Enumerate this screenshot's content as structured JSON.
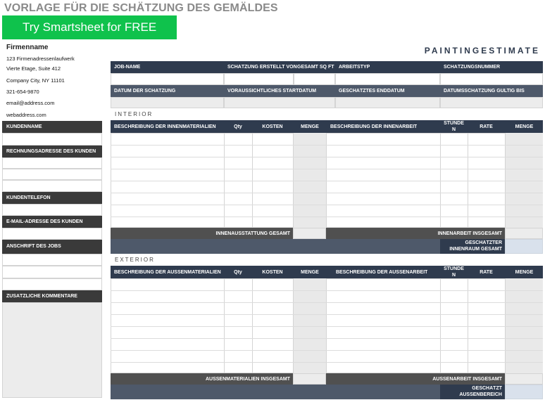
{
  "title": "VORLAGE FÜR DIE SCHÄTZUNG DES GEMÄLDES",
  "cta": "Try Smartsheet for FREE",
  "company": {
    "name": "Firmenname",
    "address1": "123 Firmenadressenlaufwerk",
    "address2": "Vierte Etage, Suite 412",
    "city": "Company City, NY 11101",
    "phone": "321-654-9870",
    "email": "email@address.com",
    "web": "webaddress.com"
  },
  "brand": "PAINTINGESTIMATE",
  "job_header": {
    "job_name": "JOB-NAME",
    "created_by": "SCHÄTZUNG ERSTELLT VON",
    "total_sqft": "GESAMT SQ FT",
    "work_type": "ARBEITSTYP",
    "estimate_no": "SCHÄTZUNGSNUMMER",
    "estimate_date": "DATUM DER SCHÄTZUNG",
    "start_date": "VORAUSSICHTLICHES STARTDATUM",
    "end_date": "GESCHÄTZTES ENDDATUM",
    "valid_until": "DATUMSSCHÄTZUNG GÜLTIG BIS"
  },
  "client": {
    "name_label": "KUNDENNAME",
    "billing_label": "RECHNUNGSADRESSE DES KUNDEN",
    "phone_label": "KUNDENTELEFON",
    "email_label": "E-MAIL-ADRESSE DES KUNDEN",
    "job_address_label": "ANSCHRIFT DES JOBS",
    "comments_label": "ZUSÄTZLICHE KOMMENTARE"
  },
  "interior": {
    "section": "INTERIOR",
    "mat_desc": "BESCHREIBUNG DER INNENMATERIALIEN",
    "qty": "Qty",
    "cost": "KOSTEN",
    "amount": "MENGE",
    "work_desc": "BESCHREIBUNG DER INNENARBEIT",
    "hours_line1": "STUNDE",
    "hours_line2": "N",
    "rate": "RATE",
    "amount2": "MENGE",
    "mat_total": "INNENAUSSTATTUNG GESAMT",
    "work_total": "INNENARBEIT INSGESAMT",
    "est_total_line1": "GESCHÄTZTER",
    "est_total_line2": "INNENRAUM GESAMT"
  },
  "exterior": {
    "section": "EXTERIOR",
    "mat_desc": "BESCHREIBUNG DER AUSSENMATERIALIEN",
    "qty": "Qty",
    "cost": "KOSTEN",
    "amount": "MENGE",
    "work_desc": "BESCHREIBUNG DER AUSSENARBEIT",
    "hours_line1": "STUNDE",
    "hours_line2": "N",
    "rate": "RATE",
    "amount2": "MENGE",
    "mat_total": "AUSSENMATERIALIEN INSGESAMT",
    "work_total": "AUSSENARBEIT INSGESAMT",
    "est_total_line1": "GESCHÄTZT",
    "est_total_line2": "AUSSENBEREICH"
  }
}
